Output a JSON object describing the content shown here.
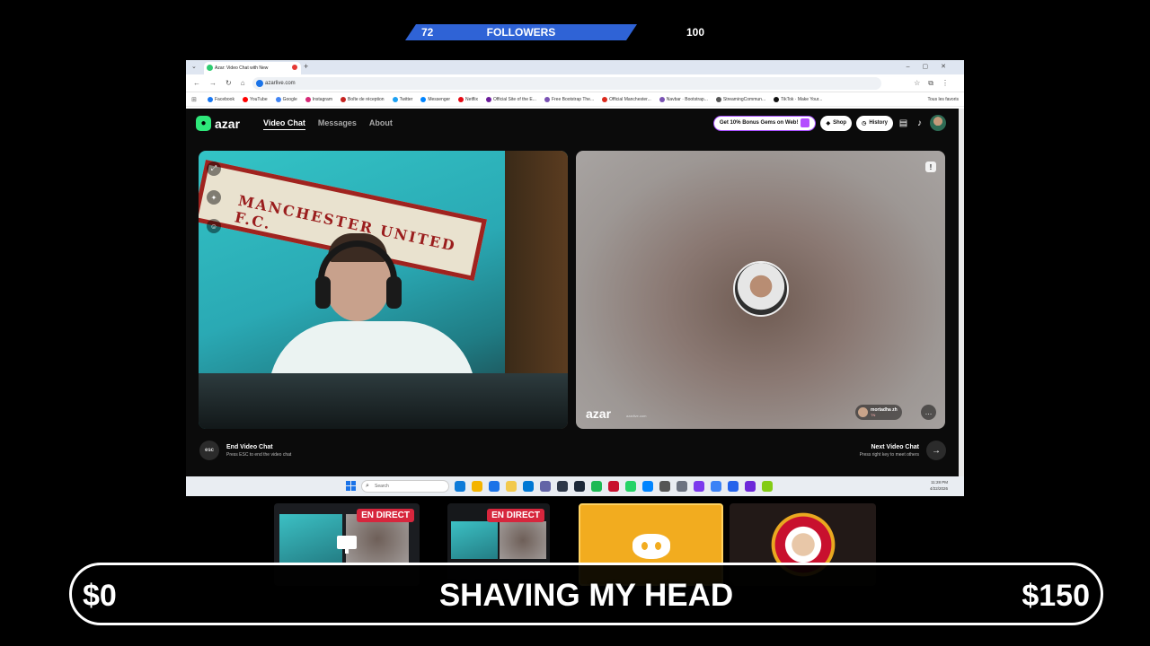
{
  "followers_bar": {
    "current": "72",
    "title": "FOLLOWERS",
    "goal": "100",
    "color": "#2f63d6"
  },
  "browser": {
    "tab_title": "Azar: Video Chat with New",
    "url": "azarlive.com",
    "bookmarks": [
      {
        "label": "Facebook",
        "color": "#1877f2"
      },
      {
        "label": "YouTube",
        "color": "#ff0000"
      },
      {
        "label": "Google",
        "color": "#4285f4"
      },
      {
        "label": "Instagram",
        "color": "#d62976"
      },
      {
        "label": "Boîte de réception",
        "color": "#c5221f"
      },
      {
        "label": "Twitter",
        "color": "#1da1f2"
      },
      {
        "label": "Messenger",
        "color": "#0084ff"
      },
      {
        "label": "Netflix",
        "color": "#e50914"
      },
      {
        "label": "Official Site of the E...",
        "color": "#6a1b9a"
      },
      {
        "label": "Free Bootstrap The...",
        "color": "#7952b3"
      },
      {
        "label": "Official Manchester...",
        "color": "#da291c"
      },
      {
        "label": "Navbar · Bootstrap...",
        "color": "#7952b3"
      },
      {
        "label": "StreamingCommun...",
        "color": "#555555"
      },
      {
        "label": "TikTok · Make Your...",
        "color": "#111111"
      }
    ],
    "all_bookmarks": "Tous les favoris"
  },
  "azar": {
    "logo": "azar",
    "nav": [
      "Video Chat",
      "Messages",
      "About"
    ],
    "promo": "Get 10% Bonus Gems on Web!",
    "shop": "Shop",
    "history": "History",
    "watermark": "azar",
    "watermark_sub": "azarlive.com",
    "partner_name": "mortadha zh",
    "partner_country": "TN",
    "end_title": "End Video Chat",
    "end_sub": "Press ESC to end the video chat",
    "esc_label": "esc",
    "next_title": "Next Video Chat",
    "next_sub": "Press right key to meet others",
    "banner_text": "MANCHESTER UNITED F.C."
  },
  "taskbar": {
    "search_placeholder": "Search",
    "time": "11:28 PM",
    "date": "4/22/2026",
    "app_colors": [
      "#0c7ad8",
      "#f4b400",
      "#1a73e8",
      "#f2c94c",
      "#0078d4",
      "#6264a7",
      "#2d3748",
      "#1b2838",
      "#1db954",
      "#c8102e",
      "#25d366",
      "#0084ff",
      "#555555",
      "#6b7280",
      "#7c3aed",
      "#3b82f6",
      "#2563eb",
      "#6d28d9",
      "#84cc16"
    ]
  },
  "thumbnails": {
    "live_label_1": "EN DIRECT",
    "live_label_2": "EN DIRECT"
  },
  "donation_goal": {
    "current": "$0",
    "title": "SHAVING MY HEAD",
    "target": "$150"
  }
}
